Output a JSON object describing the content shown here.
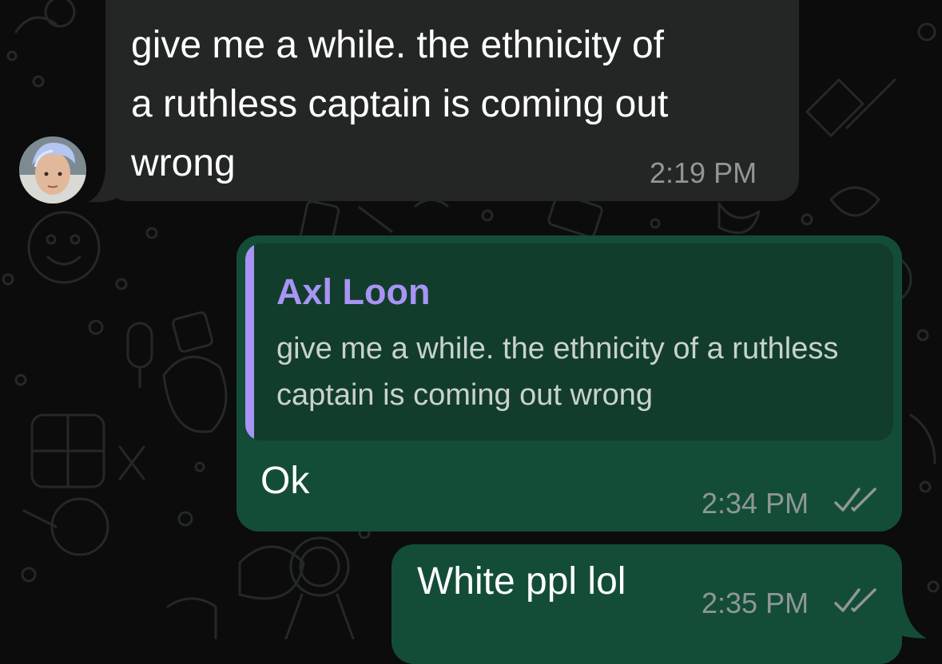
{
  "chat": {
    "incoming_message": {
      "text": "give me a while. the ethnicity of\na ruthless captain is coming out\nwrong",
      "time": "2:19 PM"
    },
    "reply_message": {
      "quoted_sender": "Axl Loon",
      "quoted_text": "give me a while. the ethnicity of a ruthless captain is coming out wrong",
      "text": "Ok",
      "time": "2:34 PM",
      "status_icon": "double-check-icon"
    },
    "last_message": {
      "text": "White ppl lol",
      "time": "2:35 PM",
      "status_icon": "double-check-icon"
    }
  },
  "colors": {
    "background": "#0b0c0b",
    "incoming_bubble": "#242626",
    "outgoing_bubble": "#134d37",
    "quote_background": "#123d2c",
    "quote_accent": "#a894f5",
    "timestamp": "#8f9795"
  }
}
